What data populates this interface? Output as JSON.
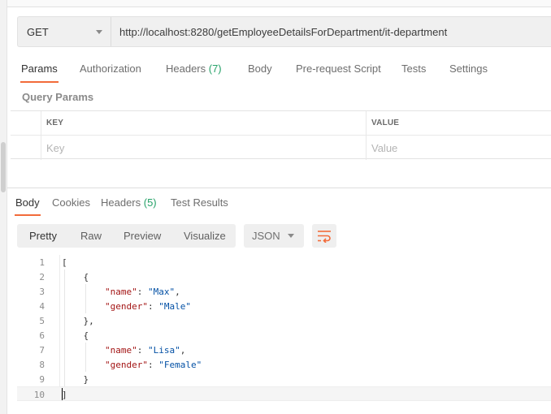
{
  "request": {
    "method": "GET",
    "url": "http://localhost:8280/getEmployeeDetailsForDepartment/it-department"
  },
  "request_tabs": [
    {
      "label": "Params",
      "count": ""
    },
    {
      "label": "Authorization",
      "count": ""
    },
    {
      "label": "Headers ",
      "count": "(7)"
    },
    {
      "label": "Body",
      "count": ""
    },
    {
      "label": "Pre-request Script",
      "count": ""
    },
    {
      "label": "Tests",
      "count": ""
    },
    {
      "label": "Settings",
      "count": ""
    }
  ],
  "query_params": {
    "title": "Query Params",
    "headers": {
      "key": "KEY",
      "value": "VALUE"
    },
    "placeholders": {
      "key": "Key",
      "value": "Value"
    }
  },
  "response_tabs": [
    {
      "label": "Body",
      "count": ""
    },
    {
      "label": "Cookies",
      "count": ""
    },
    {
      "label": "Headers ",
      "count": "(5)"
    },
    {
      "label": "Test Results",
      "count": ""
    }
  ],
  "view_modes": [
    "Pretty",
    "Raw",
    "Preview",
    "Visualize"
  ],
  "format": "JSON",
  "colors": {
    "accent": "#f26b3a",
    "count_green": "#26a269",
    "json_key": "#a31515",
    "json_string": "#0451a5"
  },
  "icons": {
    "wrap": "wrap-lines-icon",
    "dropdown": "chevron-down-icon"
  },
  "response_lines": [
    {
      "n": "1",
      "pre": "[",
      "key": "",
      "mid": "",
      "val": "",
      "post": ""
    },
    {
      "n": "2",
      "pre": "    {",
      "key": "",
      "mid": "",
      "val": "",
      "post": ""
    },
    {
      "n": "3",
      "pre": "        ",
      "key": "\"name\"",
      "mid": ": ",
      "val": "\"Max\"",
      "post": ","
    },
    {
      "n": "4",
      "pre": "        ",
      "key": "\"gender\"",
      "mid": ": ",
      "val": "\"Male\"",
      "post": ""
    },
    {
      "n": "5",
      "pre": "    },",
      "key": "",
      "mid": "",
      "val": "",
      "post": ""
    },
    {
      "n": "6",
      "pre": "    {",
      "key": "",
      "mid": "",
      "val": "",
      "post": ""
    },
    {
      "n": "7",
      "pre": "        ",
      "key": "\"name\"",
      "mid": ": ",
      "val": "\"Lisa\"",
      "post": ","
    },
    {
      "n": "8",
      "pre": "        ",
      "key": "\"gender\"",
      "mid": ": ",
      "val": "\"Female\"",
      "post": ""
    },
    {
      "n": "9",
      "pre": "    }",
      "key": "",
      "mid": "",
      "val": "",
      "post": ""
    },
    {
      "n": "10",
      "pre": "]",
      "key": "",
      "mid": "",
      "val": "",
      "post": ""
    }
  ]
}
